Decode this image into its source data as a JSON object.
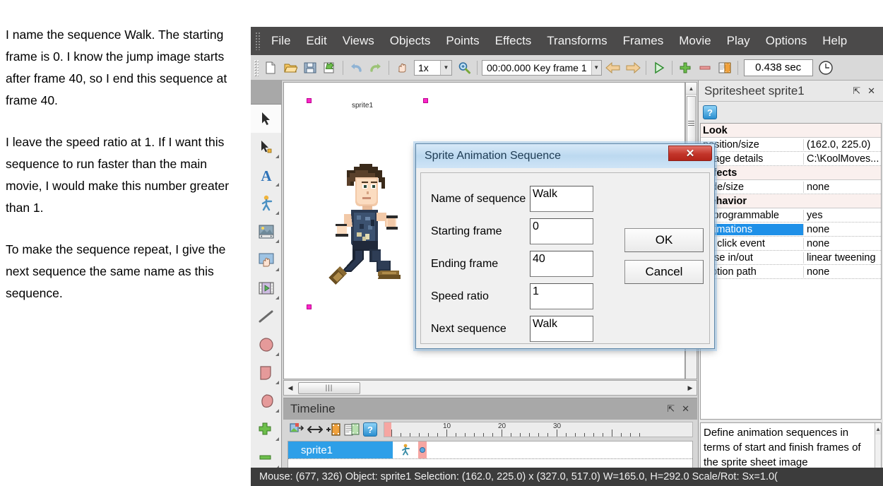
{
  "narrative": {
    "paragraphs": [
      "I name the sequence Walk. The starting frame is 0. I know the jump image starts after frame 40, so I end this sequence at frame 40.",
      "I leave the speed ratio at 1. If I want this sequence to run faster than the main movie, I would make this number greater than 1.",
      "To make the sequence repeat, I give the next sequence the same name as this sequence."
    ]
  },
  "menubar": {
    "items": [
      {
        "label": "File"
      },
      {
        "label": "Edit"
      },
      {
        "label": "Views"
      },
      {
        "label": "Objects"
      },
      {
        "label": "Points"
      },
      {
        "label": "Effects"
      },
      {
        "label": "Transforms"
      },
      {
        "label": "Frames"
      },
      {
        "label": "Movie"
      },
      {
        "label": "Play"
      },
      {
        "label": "Options"
      },
      {
        "label": "Help"
      }
    ]
  },
  "toolbar": {
    "icons": [
      {
        "name": "new-document-icon"
      },
      {
        "name": "open-folder-icon"
      },
      {
        "name": "save-icon"
      },
      {
        "name": "export-icon"
      },
      {
        "name": "undo-icon"
      },
      {
        "name": "redo-icon"
      },
      {
        "name": "pan-hand-icon"
      }
    ],
    "zoom_value": "1x",
    "zoom_icon": "magnifier-icon",
    "time_value": "00:00.000  Key frame 1",
    "prev_icon": "arrow-left-icon",
    "next_icon": "arrow-right-icon",
    "play_icon": "play-icon",
    "add_icon": "plus-icon",
    "remove_icon": "minus-icon",
    "frames_icon": "frames-icon",
    "duration_value": "0.438 sec",
    "clock_icon": "clock-icon"
  },
  "tools": [
    {
      "name": "select-arrow-tool"
    },
    {
      "name": "point-select-tool"
    },
    {
      "name": "text-tool"
    },
    {
      "name": "figure-tool"
    },
    {
      "name": "image-tool"
    },
    {
      "name": "hand-grab-tool"
    },
    {
      "name": "movie-clip-tool"
    },
    {
      "name": "line-tool"
    },
    {
      "name": "ellipse-tool"
    },
    {
      "name": "shape-tool"
    },
    {
      "name": "blob-tool"
    },
    {
      "name": "add-point-tool"
    },
    {
      "name": "remove-point-tool"
    }
  ],
  "canvas": {
    "sprite_label": "sprite1"
  },
  "timeline": {
    "title": "Timeline",
    "pin_icon": "pin-icon",
    "close_icon": "close-icon",
    "tools": [
      {
        "name": "insert-object-icon"
      },
      {
        "name": "stretch-icon"
      },
      {
        "name": "add-frame-icon"
      },
      {
        "name": "copy-frames-icon"
      },
      {
        "name": "help-icon"
      }
    ],
    "ruler_labels": [
      "10",
      "20",
      "30"
    ],
    "track_name": "sprite1",
    "track_icon": "figure-icon",
    "keyframe_marker": "keyframe-dot"
  },
  "right_panel": {
    "title": "Spritesheet sprite1",
    "pin_icon": "pin-icon",
    "close_icon": "close-icon",
    "help_icon": "help-icon",
    "properties": [
      {
        "name": "Look",
        "value": "",
        "group": true,
        "selected": false
      },
      {
        "name": "position/size",
        "value": "(162.0, 225.0)",
        "group": false,
        "selected": false
      },
      {
        "name": "image details",
        "value": "C:\\KoolMoves...",
        "group": false,
        "selected": false
      },
      {
        "name": "Effects",
        "value": "",
        "group": true,
        "selected": false
      },
      {
        "name": "fade/size",
        "value": "none",
        "group": false,
        "selected": false
      },
      {
        "name": "Behavior",
        "value": "",
        "group": true,
        "selected": false
      },
      {
        "name": "is programmable",
        "value": "yes",
        "group": false,
        "selected": false
      },
      {
        "name": "animations",
        "value": "none",
        "group": false,
        "selected": true
      },
      {
        "name": "on click event",
        "value": "none",
        "group": false,
        "selected": false
      },
      {
        "name": "ease in/out",
        "value": "linear tweening",
        "group": false,
        "selected": false
      },
      {
        "name": "motion path",
        "value": "none",
        "group": false,
        "selected": false
      }
    ],
    "help_text": "Define animation sequences in terms of start and finish frames of the sprite sheet image"
  },
  "dialog": {
    "title": "Sprite Animation Sequence",
    "close_label": "✕",
    "fields": [
      {
        "label": "Name of sequence",
        "value": "Walk"
      },
      {
        "label": "Starting frame",
        "value": "0"
      },
      {
        "label": "Ending frame",
        "value": "40"
      },
      {
        "label": "Speed ratio",
        "value": "1"
      },
      {
        "label": "Next sequence",
        "value": "Walk"
      }
    ],
    "ok_label": "OK",
    "cancel_label": "Cancel"
  },
  "statusbar": {
    "text": "Mouse: (677, 326)  Object: sprite1  Selection: (162.0, 225.0) x (327.0, 517.0)  W=165.0,  H=292.0  Scale/Rot: Sx=1.0("
  },
  "colors": {
    "menubar_bg": "#4b4a4a",
    "accent_selection": "#1e90e8",
    "handle_magenta": "#ff26c9",
    "playhead": "#f6a6a2",
    "statusbar_bg": "#3c3c3c"
  }
}
